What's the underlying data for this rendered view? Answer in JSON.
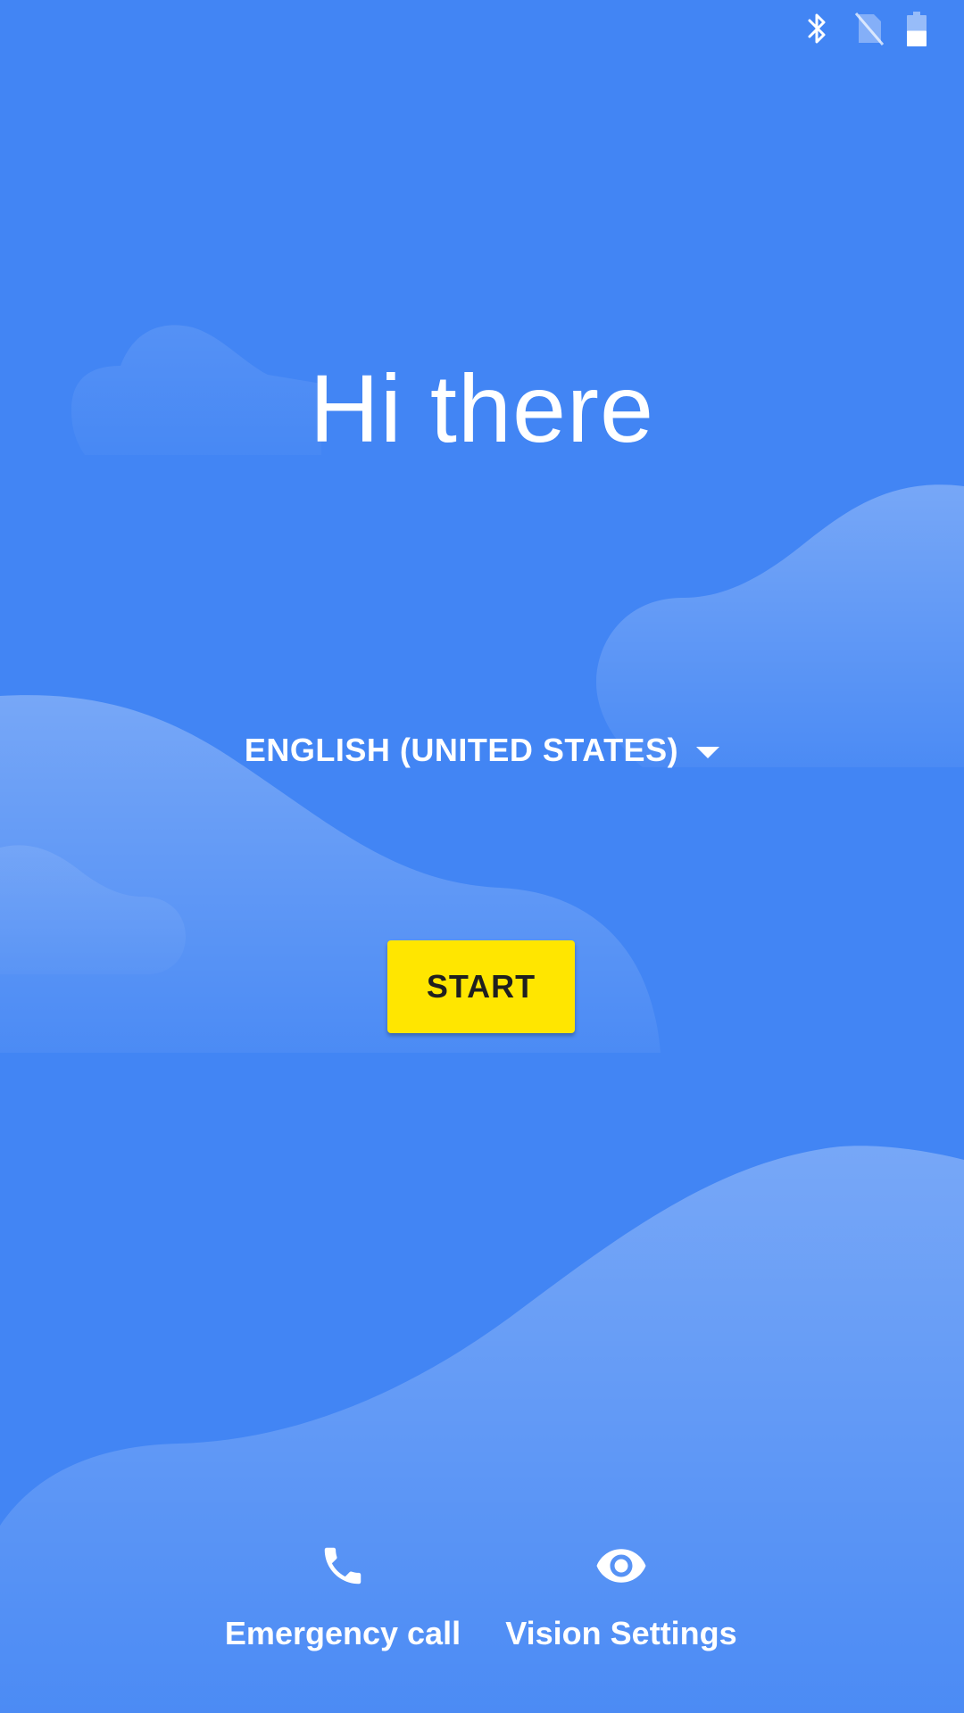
{
  "status_bar": {
    "icons": [
      "bluetooth-icon",
      "no-sim-icon",
      "battery-icon"
    ],
    "battery_level": 0.5
  },
  "welcome": {
    "title": "Hi there"
  },
  "language_selector": {
    "value": "ENGLISH (UNITED STATES)"
  },
  "start_button": {
    "label": "START"
  },
  "bottom_actions": {
    "emergency": {
      "label": "Emergency call",
      "icon": "phone-icon"
    },
    "vision": {
      "label": "Vision Settings",
      "icon": "eye-icon"
    }
  },
  "colors": {
    "background": "#4285F4",
    "accent_button": "#FFE600",
    "text": "#FFFFFF"
  }
}
